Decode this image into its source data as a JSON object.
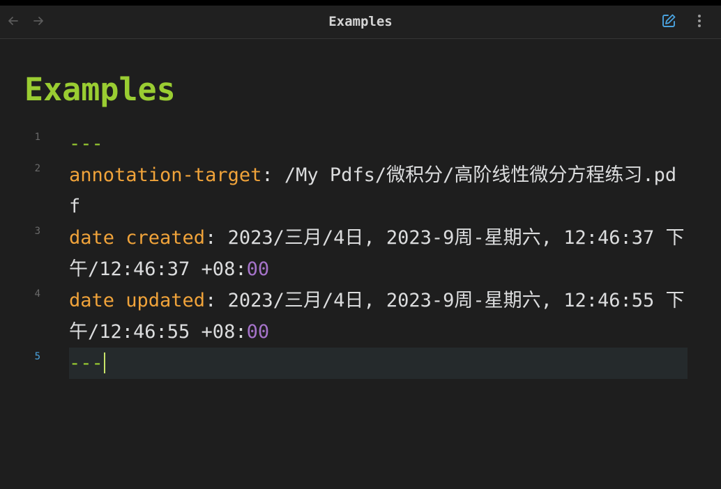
{
  "header": {
    "title": "Examples",
    "back_icon": "arrow-left-icon",
    "forward_icon": "arrow-right-icon",
    "edit_icon": "edit-icon",
    "more_icon": "more-vertical-icon",
    "accent_color": "#4aa3df"
  },
  "document": {
    "title": "Examples",
    "title_color": "#9acd32"
  },
  "editor": {
    "lines": [
      {
        "number": "1",
        "dashes": "---"
      },
      {
        "number": "2",
        "key": "annotation-target",
        "sep": ": ",
        "value": "/My Pdfs/微积分/高阶线性微分方程练习.pdf"
      },
      {
        "number": "3",
        "key": "date created",
        "sep": ": ",
        "value": "2023/三月/4日, 2023-9周-星期六, 12:46:37 下午/12:46:37 +08:",
        "value_tail": "00"
      },
      {
        "number": "4",
        "key": "date updated",
        "sep": ": ",
        "value": "2023/三月/4日, 2023-9周-星期六, 12:46:55 下午/12:46:55 +08:",
        "value_tail": "00"
      },
      {
        "number": "5",
        "dashes": "---"
      }
    ],
    "colors": {
      "key": "#f0a33a",
      "dashes": "#9acd32",
      "number_tail": "#a573c9"
    }
  }
}
